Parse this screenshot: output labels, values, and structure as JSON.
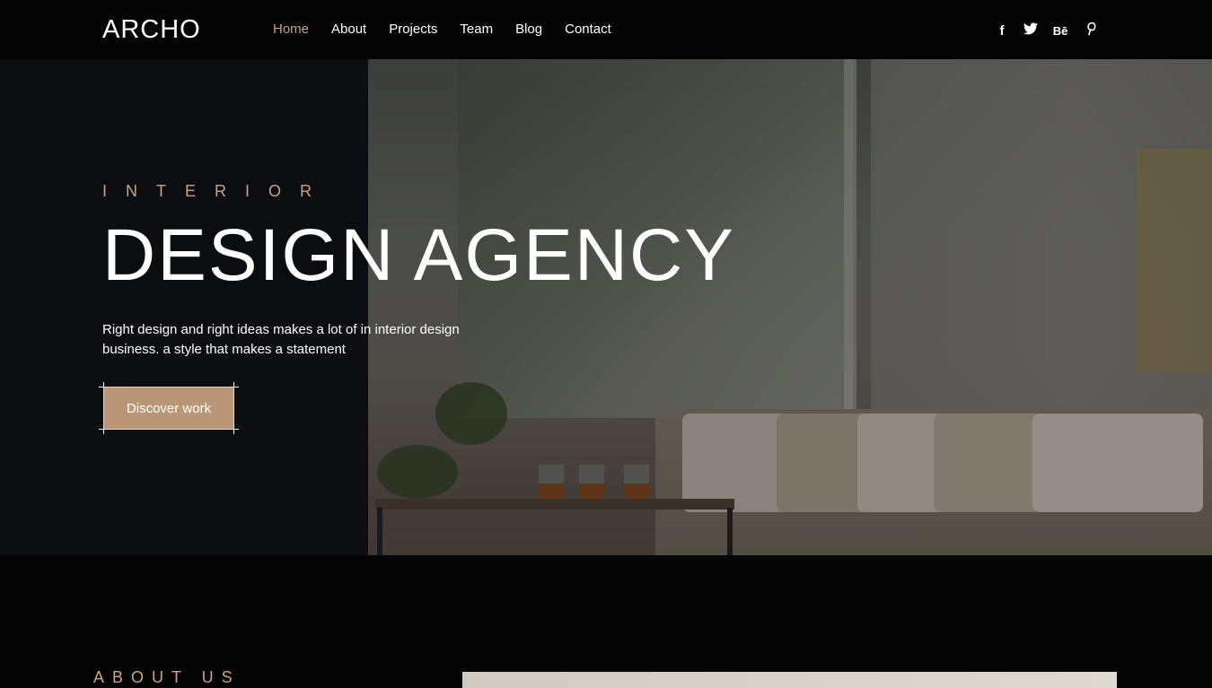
{
  "brand": {
    "logo": "ARCHO"
  },
  "nav": {
    "items": [
      {
        "label": "Home",
        "active": true
      },
      {
        "label": "About",
        "active": false
      },
      {
        "label": "Projects",
        "active": false
      },
      {
        "label": "Team",
        "active": false
      },
      {
        "label": "Blog",
        "active": false
      },
      {
        "label": "Contact",
        "active": false
      }
    ]
  },
  "social": [
    {
      "icon": "facebook-icon",
      "glyph": "f"
    },
    {
      "icon": "twitter-icon",
      "glyph": "🐦"
    },
    {
      "icon": "behance-icon",
      "glyph": "Bē"
    },
    {
      "icon": "pinterest-icon",
      "glyph": "P"
    }
  ],
  "hero": {
    "eyebrow": "INTERIOR",
    "headline": "DESIGN AGENCY",
    "description": "Right design and right ideas makes a lot of in interior design business. a style that makes a statement",
    "cta": "Discover work"
  },
  "about": {
    "label": "ABOUT US"
  },
  "colors": {
    "accent": "#c5a489",
    "button": "#b89677",
    "background": "#040405",
    "panel": "#0c0d11"
  }
}
